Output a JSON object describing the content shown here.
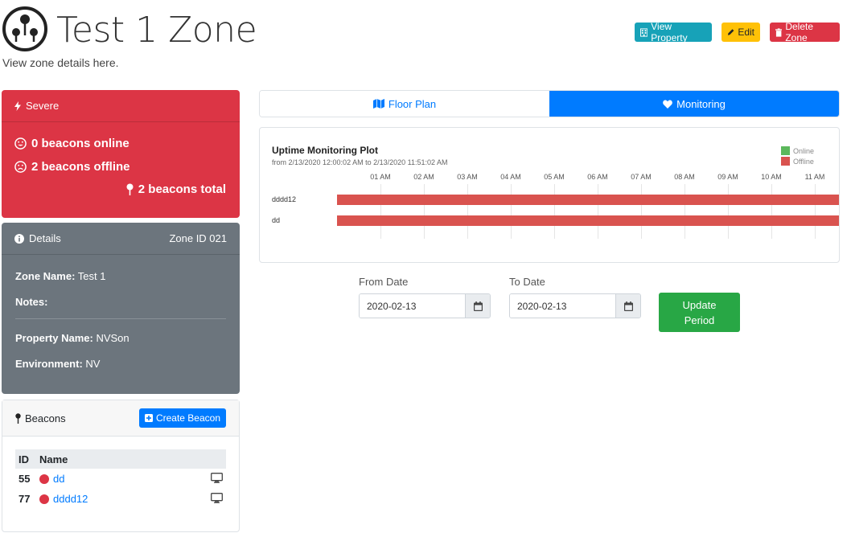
{
  "header": {
    "title": "Test 1 Zone",
    "subtitle": "View zone details here.",
    "view_property_label": "View Property",
    "edit_label": "Edit",
    "delete_zone_label": "Delete Zone"
  },
  "status_card": {
    "label": "Severe",
    "online_text": "0 beacons online",
    "offline_text": "2 beacons offline",
    "total_text": "2 beacons total"
  },
  "details_card": {
    "label": "Details",
    "zone_id": "Zone ID 021",
    "zone_name_label": "Zone Name:",
    "zone_name": "Test 1",
    "notes_label": "Notes:",
    "notes": "",
    "property_name_label": "Property Name:",
    "property_name": "NVSon",
    "environment_label": "Environment:",
    "environment": "NV"
  },
  "beacons_card": {
    "label": "Beacons",
    "create_label": "Create Beacon",
    "columns": [
      "ID",
      "Name"
    ],
    "rows": [
      {
        "id": "55",
        "name": "dd"
      },
      {
        "id": "77",
        "name": "dddd12"
      }
    ]
  },
  "tabs": [
    {
      "label": "Floor Plan",
      "active": false
    },
    {
      "label": "Monitoring",
      "active": true
    }
  ],
  "colors": {
    "online": "#5cb85c",
    "offline": "#d9534f",
    "primary": "#007bff",
    "danger": "#dc3545"
  },
  "chart_data": {
    "type": "timeline",
    "title": "Uptime Monitoring Plot",
    "subtitle": "from 2/13/2020 12:00:02 AM to 2/13/2020 11:51:02 AM",
    "x_ticks": [
      "01 AM",
      "02 AM",
      "03 AM",
      "04 AM",
      "05 AM",
      "06 AM",
      "07 AM",
      "08 AM",
      "09 AM",
      "10 AM",
      "11 AM"
    ],
    "legend": [
      {
        "name": "Online",
        "color": "#5cb85c"
      },
      {
        "name": "Offline",
        "color": "#d9534f"
      }
    ],
    "series": [
      {
        "name": "dddd12",
        "status": "Offline",
        "start": "12:00:02 AM",
        "end": "11:51:02 AM"
      },
      {
        "name": "dd",
        "status": "Offline",
        "start": "12:00:02 AM",
        "end": "11:51:02 AM"
      }
    ]
  },
  "date_form": {
    "from_label": "From Date",
    "from_value": "2020-02-13",
    "to_label": "To Date",
    "to_value": "2020-02-13",
    "update_label": "Update Period"
  }
}
